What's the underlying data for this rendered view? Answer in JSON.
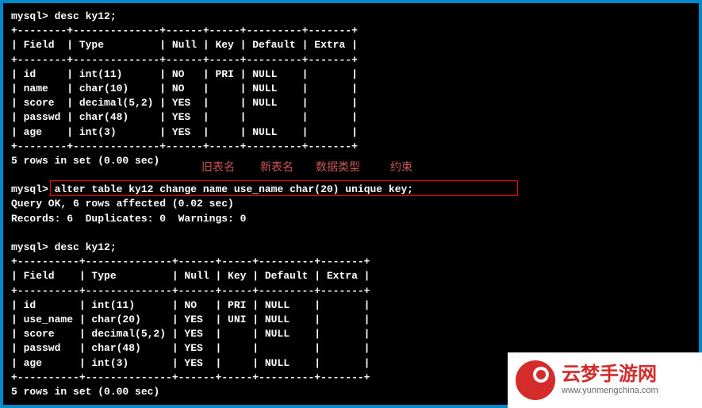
{
  "terminal": {
    "prompt": "mysql>",
    "cmd1": "desc ky12;",
    "table1": {
      "divider": "+--------+--------------+------+-----+---------+-------+",
      "header": "| Field  | Type         | Null | Key | Default | Extra |",
      "rows": [
        "| id     | int(11)      | NO   | PRI | NULL    |       |",
        "| name   | char(10)     | NO   |     | NULL    |       |",
        "| score  | decimal(5,2) | YES  |     | NULL    |       |",
        "| passwd | char(48)     | YES  |     |         |       |",
        "| age    | int(3)       | YES  |     | NULL    |       |"
      ]
    },
    "result1": "5 rows in set (0.00 sec)",
    "annotations": {
      "label1": "旧表名",
      "label2": "新表名",
      "label3": "数据类型",
      "label4": "约束"
    },
    "cmd2": "alter table ky12 change name use_name char(20) unique key;",
    "result2a": "Query OK, 6 rows affected (0.02 sec)",
    "result2b": "Records: 6  Duplicates: 0  Warnings: 0",
    "cmd3": "desc ky12;",
    "table2": {
      "divider": "+----------+--------------+------+-----+---------+-------+",
      "header": "| Field    | Type         | Null | Key | Default | Extra |",
      "rows": [
        "| id       | int(11)      | NO   | PRI | NULL    |       |",
        "| use_name | char(20)     | YES  | UNI | NULL    |       |",
        "| score    | decimal(5,2) | YES  |     | NULL    |       |",
        "| passwd   | char(48)     | YES  |     |         |       |",
        "| age      | int(3)       | YES  |     | NULL    |       |"
      ]
    },
    "result3": "5 rows in set (0.00 sec)"
  },
  "watermark": {
    "title": "云梦手游网",
    "url": "www.yunmengchina.com"
  },
  "chart_data": {
    "type": "table",
    "title": "MySQL ALTER TABLE demonstration",
    "before": {
      "table_name": "ky12",
      "columns": [
        {
          "Field": "id",
          "Type": "int(11)",
          "Null": "NO",
          "Key": "PRI",
          "Default": "NULL",
          "Extra": ""
        },
        {
          "Field": "name",
          "Type": "char(10)",
          "Null": "NO",
          "Key": "",
          "Default": "NULL",
          "Extra": ""
        },
        {
          "Field": "score",
          "Type": "decimal(5,2)",
          "Null": "YES",
          "Key": "",
          "Default": "NULL",
          "Extra": ""
        },
        {
          "Field": "passwd",
          "Type": "char(48)",
          "Null": "YES",
          "Key": "",
          "Default": "",
          "Extra": ""
        },
        {
          "Field": "age",
          "Type": "int(3)",
          "Null": "YES",
          "Key": "",
          "Default": "NULL",
          "Extra": ""
        }
      ]
    },
    "command": "alter table ky12 change name use_name char(20) unique key;",
    "after": {
      "table_name": "ky12",
      "columns": [
        {
          "Field": "id",
          "Type": "int(11)",
          "Null": "NO",
          "Key": "PRI",
          "Default": "NULL",
          "Extra": ""
        },
        {
          "Field": "use_name",
          "Type": "char(20)",
          "Null": "YES",
          "Key": "UNI",
          "Default": "NULL",
          "Extra": ""
        },
        {
          "Field": "score",
          "Type": "decimal(5,2)",
          "Null": "YES",
          "Key": "",
          "Default": "NULL",
          "Extra": ""
        },
        {
          "Field": "passwd",
          "Type": "char(48)",
          "Null": "YES",
          "Key": "",
          "Default": "",
          "Extra": ""
        },
        {
          "Field": "age",
          "Type": "int(3)",
          "Null": "YES",
          "Key": "",
          "Default": "NULL",
          "Extra": ""
        }
      ]
    }
  }
}
